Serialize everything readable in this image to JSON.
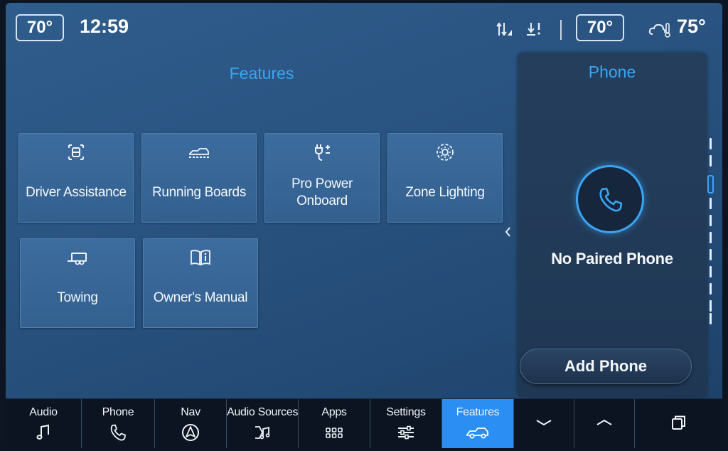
{
  "status_bar": {
    "driver_temp": "70°",
    "clock": "12:59",
    "passenger_temp": "70°",
    "outside_temp": "75°",
    "icons": [
      "signal-up-down-icon",
      "download-alert-icon",
      "weather-cloud-icon"
    ]
  },
  "features": {
    "title": "Features",
    "tiles": [
      {
        "label": "Driver Assistance",
        "icon": "driver-assist-icon"
      },
      {
        "label": "Running Boards",
        "icon": "running-boards-icon"
      },
      {
        "label": "Pro Power Onboard",
        "icon": "power-plug-icon"
      },
      {
        "label": "Zone Lighting",
        "icon": "zone-lighting-icon"
      },
      {
        "label": "Towing",
        "icon": "trailer-icon"
      },
      {
        "label": "Owner's Manual",
        "icon": "manual-book-icon"
      }
    ]
  },
  "phone_panel": {
    "title": "Phone",
    "status": "No Paired Phone",
    "add_button": "Add Phone",
    "icon": "phone-icon"
  },
  "bottom_nav": {
    "items": [
      {
        "label": "Audio",
        "icon": "music-note-icon"
      },
      {
        "label": "Phone",
        "icon": "phone-icon"
      },
      {
        "label": "Nav",
        "icon": "navigation-icon"
      },
      {
        "label": "Audio Sources",
        "icon": "audio-sources-icon"
      },
      {
        "label": "Apps",
        "icon": "apps-grid-icon"
      },
      {
        "label": "Settings",
        "icon": "sliders-icon"
      },
      {
        "label": "Features",
        "icon": "truck-icon"
      }
    ],
    "active": "Features",
    "extra_icons": [
      "chevron-down-icon",
      "chevron-up-icon",
      "window-stack-icon"
    ]
  },
  "colors": {
    "accent": "#39a6f5",
    "active_tab": "#2a8ef2",
    "background": "#2a5482"
  }
}
